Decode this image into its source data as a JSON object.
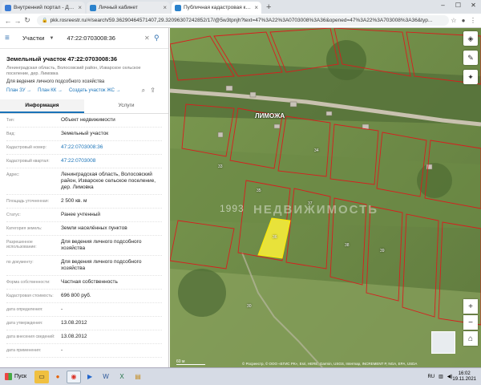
{
  "browser": {
    "tabs": [
      {
        "title": "Внутренний портал - Домашн",
        "color": "#3a7bd5",
        "active": false
      },
      {
        "title": "Личный кабинет",
        "color": "#2b82cc",
        "active": false
      },
      {
        "title": "Публичная кадастровая карта",
        "color": "#2b82cc",
        "active": true
      }
    ],
    "new_tab": "+",
    "url": "pkk.rosreestr.ru/#/search/59.36290464571407,29.32096307242852/17/@5w3tpnjh?text=47%3A22%3A0703008%3A36&opened=47%3A22%3A703008%3A36&typ..."
  },
  "panel": {
    "search_category": "Участки",
    "search_query": "47:22:0703008:36",
    "object_title": "Земельный участок 47:22:0703008:36",
    "object_address": "Ленинградская область, Волосовский район, Изварское сельское поселение, дер. Лимовка",
    "object_use": "Для ведения личного подсобного хозяйства",
    "actions": [
      "План ЗУ →",
      "План КК →",
      "Создать участок ЖС →"
    ],
    "tabs": [
      "Информация",
      "Услуги"
    ],
    "properties": [
      {
        "k": "Тип:",
        "v": "Объект недвижимости",
        "link": false
      },
      {
        "k": "Вид:",
        "v": "Земельный участок",
        "link": false
      },
      {
        "k": "Кадастровый номер:",
        "v": "47:22:0703008:36",
        "link": true
      },
      {
        "k": "Кадастровый квартал:",
        "v": "47:22:0703008",
        "link": true
      },
      {
        "k": "Адрес:",
        "v": "Ленинградская область, Волосовский район, Изварское сельское поселение, дер. Лимовка",
        "link": false
      },
      {
        "k": "Площадь уточненная:",
        "v": "2 500 кв. м",
        "link": false
      },
      {
        "k": "Статус:",
        "v": "Ранее учтенный",
        "link": false
      },
      {
        "k": "Категория земель:",
        "v": "Земли населённых пунктов",
        "link": false
      },
      {
        "k": "Разрешенное использование:",
        "v": "Для ведения личного подсобного хозяйства",
        "link": false
      },
      {
        "k": "по документу:",
        "v": "Для ведения личного подсобного хозяйства",
        "link": false
      },
      {
        "k": "Форма собственности:",
        "v": "Частная собственность",
        "link": false
      },
      {
        "k": "Кадастровая стоимость:",
        "v": "696 800 руб.",
        "link": false
      },
      {
        "k": "дата определения:",
        "v": "-",
        "link": false
      },
      {
        "k": "дата утверждения:",
        "v": "13.08.2012",
        "link": false
      },
      {
        "k": "дата внесения сведений:",
        "v": "13.08.2012",
        "link": false
      },
      {
        "k": "дата применения:",
        "v": "-",
        "link": false
      }
    ]
  },
  "map": {
    "village_label": "ЛИМОЖА",
    "watermark_year": "1993",
    "watermark_text": "НЕДВИЖИМОСТЬ",
    "attribution": "© Росреестр, © ООО «ЕГИС РК», Esri, HERE, Garmin, USGS, Intermap, INCREMENT P, NGA, EPA, USDA",
    "scale": "60 м",
    "parcel_labels": [
      "36",
      "35",
      "37",
      "38",
      "39",
      "33",
      "34",
      "30"
    ],
    "highlight_color": "#e8e23a",
    "boundary_color": "#d81e1e"
  },
  "taskbar": {
    "start_label": "Пуск",
    "lang": "RU",
    "time": "16:02",
    "date": "19.11.2021"
  }
}
